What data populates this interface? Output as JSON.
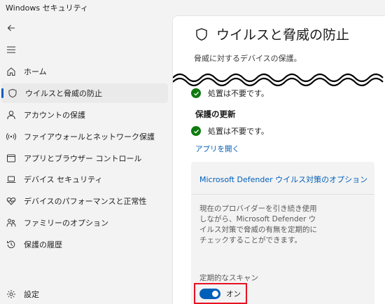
{
  "window": {
    "title": "Windows セキュリティ"
  },
  "nav": {
    "back_icon": "back-arrow-icon",
    "menu_icon": "hamburger-menu-icon",
    "items": [
      {
        "label": "ホーム",
        "icon": "home-icon"
      },
      {
        "label": "ウイルスと脅威の防止",
        "icon": "shield-icon",
        "selected": true
      },
      {
        "label": "アカウントの保護",
        "icon": "person-icon"
      },
      {
        "label": "ファイアウォールとネットワーク保護",
        "icon": "wifi-icon"
      },
      {
        "label": "アプリとブラウザー コントロール",
        "icon": "app-window-icon"
      },
      {
        "label": "デバイス セキュリティ",
        "icon": "laptop-icon"
      },
      {
        "label": "デバイスのパフォーマンスと正常性",
        "icon": "heart-pulse-icon"
      },
      {
        "label": "ファミリーのオプション",
        "icon": "family-icon"
      },
      {
        "label": "保護の履歴",
        "icon": "history-icon"
      }
    ],
    "settings": {
      "label": "設定",
      "icon": "gear-icon"
    }
  },
  "main": {
    "title": "ウイルスと脅威の防止",
    "title_icon": "shield-icon",
    "subtitle": "脅威に対するデバイスの保護。",
    "status_1": "処置は不要です。",
    "update_heading": "保護の更新",
    "status_2": "処置は不要です。",
    "open_app_link": "アプリを開く",
    "defender_card": {
      "title": "Microsoft Defender ウイルス対策のオプション",
      "description": "現在のプロバイダーを引き続き使用しながら、Microsoft Defender ウイルス対策で脅威の有無を定期的にチェックすることができます。",
      "toggle_label": "定期的なスキャン",
      "toggle_state": "オン",
      "toggle_on": true
    }
  },
  "colors": {
    "accent": "#005fb8",
    "check": "#0f7b0f",
    "highlight_box": "#e81123"
  }
}
